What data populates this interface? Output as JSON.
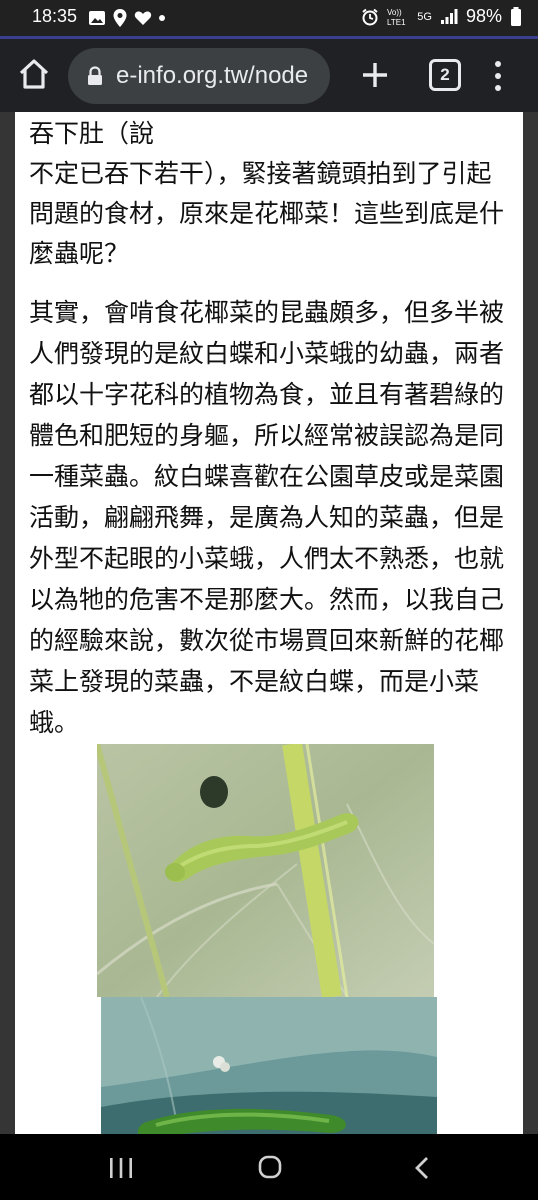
{
  "status_bar": {
    "time": "18:35",
    "network": "5G",
    "battery": "98%",
    "left_icons": [
      "gallery-icon",
      "location-icon",
      "heart-icon",
      "dot-icon"
    ],
    "right_icons": [
      "alarm-icon",
      "volte-icon",
      "signal-icon",
      "battery-icon"
    ]
  },
  "toolbar": {
    "url": "e-info.org.tw/node",
    "tab_count": "2",
    "icons": [
      "home-icon",
      "lock-icon",
      "plus-icon",
      "tabs-icon",
      "menu-icon"
    ]
  },
  "article": {
    "paragraph1_lines": [
      "吞下肚（說",
      "不定已吞下若干），緊接著鏡頭拍到了引起",
      "問題的食材，原來是花椰菜！這些到底是什",
      "麼蟲呢？"
    ],
    "paragraph2_lines": [
      "其實，會啃食花椰菜的昆蟲頗多，但多半被",
      "人們發現的是紋白蝶和小菜蛾的幼蟲，兩者",
      "都以十字花科的植物為食，並且有著碧綠的",
      "體色和肥短的身軀，所以經常被誤認為是同",
      "一種菜蟲。紋白蝶喜歡在公園草皮或是菜園",
      "活動，翩翩飛舞，是廣為人知的菜蟲，但是",
      "外型不起眼的小菜蛾，人們太不熟悉，也就",
      "以為牠的危害不是那麼大。然而，以我自己",
      "的經驗來說，數次從市場買回來新鮮的花椰",
      "菜上發現的菜蟲，不是紋白蝶，而是小菜",
      "蛾。"
    ]
  },
  "colors": {
    "status_bg": "#212121",
    "toolbar_bg": "#202124",
    "urlbar_bg": "#3c4043",
    "accent_line": "#3a3f8f",
    "page_bg": "#ffffff",
    "text": "#111111"
  },
  "nav_bar": {
    "icons": [
      "recents-icon",
      "home-circle-icon",
      "back-icon"
    ]
  }
}
